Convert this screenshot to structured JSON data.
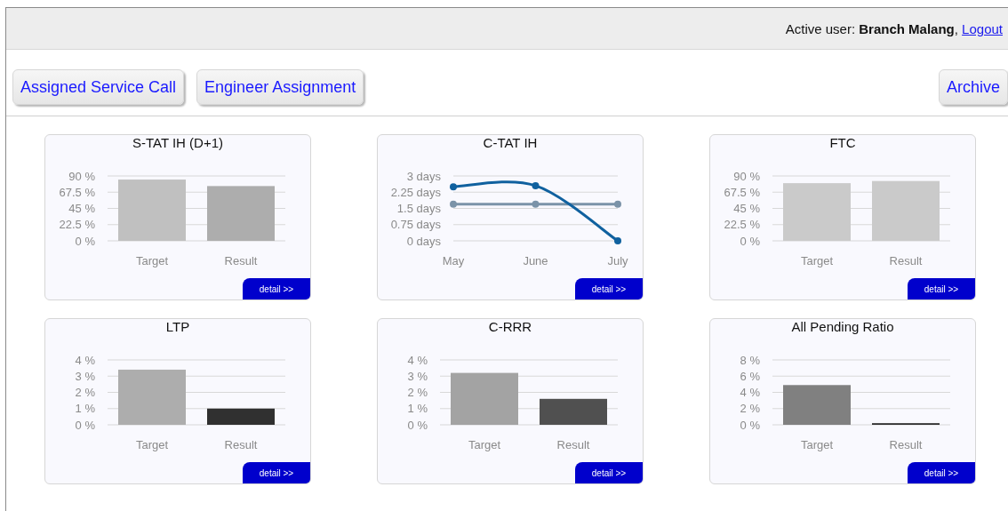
{
  "header": {
    "user_text": "Active user: **Branch Malang**,",
    "logout": "Logout"
  },
  "nav": {
    "left": [
      {
        "label": "Assigned Service Call"
      },
      {
        "label": "Engineer Assignment"
      }
    ],
    "right": [
      {
        "label": "Archive"
      }
    ]
  },
  "cards": [
    {
      "title": "S-TAT IH (D+1)",
      "detail": "detail >>",
      "chart_data": {
        "type": "bar",
        "grid": true,
        "categories": [
          "Target",
          "Result"
        ],
        "series": [
          {
            "color": "#c0c0c0",
            "values": [
              85,
              null
            ]
          },
          {
            "color": "#adadad",
            "values": [
              null,
              76
            ]
          }
        ],
        "ylim": [
          0,
          90
        ],
        "yticks": [
          {
            "value": 0,
            "label": "0 %"
          },
          {
            "value": 22.5,
            "label": "22.5 %"
          },
          {
            "value": 45,
            "label": "45 %"
          },
          {
            "value": 67.5,
            "label": "67.5 %"
          },
          {
            "value": 90,
            "label": "90 %"
          }
        ]
      }
    },
    {
      "title": "C-TAT IH",
      "detail": "detail >>",
      "chart_data": {
        "type": "line",
        "grid": true,
        "categories": [
          "May",
          "June",
          "July"
        ],
        "series": [
          {
            "color": "#7b93a8",
            "marker": true,
            "values": [
              1.7,
              1.7,
              1.7
            ]
          },
          {
            "color": "#10619f",
            "marker": true,
            "values": [
              2.5,
              2.55,
              0
            ]
          }
        ],
        "ylim": [
          0,
          3
        ],
        "yticks": [
          {
            "value": 0,
            "label": "0 days"
          },
          {
            "value": 0.75,
            "label": "0.75 days"
          },
          {
            "value": 1.5,
            "label": "1.5 days"
          },
          {
            "value": 2.25,
            "label": "2.25 days"
          },
          {
            "value": 3,
            "label": "3 days"
          }
        ]
      }
    },
    {
      "title": "FTC",
      "detail": "detail >>",
      "chart_data": {
        "type": "bar",
        "grid": true,
        "categories": [
          "Target",
          "Result"
        ],
        "series": [
          {
            "color": "#cacaca",
            "values": [
              80,
              null
            ]
          },
          {
            "color": "#cacaca",
            "values": [
              null,
              83
            ]
          }
        ],
        "ylim": [
          0,
          90
        ],
        "yticks": [
          {
            "value": 0,
            "label": "0 %"
          },
          {
            "value": 22.5,
            "label": "22.5 %"
          },
          {
            "value": 45,
            "label": "45 %"
          },
          {
            "value": 67.5,
            "label": "67.5 %"
          },
          {
            "value": 90,
            "label": "90 %"
          }
        ]
      }
    },
    {
      "title": "LTP",
      "detail": "detail >>",
      "chart_data": {
        "type": "bar",
        "grid": true,
        "categories": [
          "Target",
          "Result"
        ],
        "series": [
          {
            "color": "#adadad",
            "values": [
              3.4,
              null
            ]
          },
          {
            "color": "#303030",
            "values": [
              null,
              1
            ]
          }
        ],
        "ylim": [
          0,
          4
        ],
        "yticks": [
          {
            "value": 0,
            "label": "0 %"
          },
          {
            "value": 1,
            "label": "1 %"
          },
          {
            "value": 2,
            "label": "2 %"
          },
          {
            "value": 3,
            "label": "3 %"
          },
          {
            "value": 4,
            "label": "4 %"
          }
        ]
      }
    },
    {
      "title": "C-RRR",
      "detail": "detail >>",
      "chart_data": {
        "type": "bar",
        "grid": true,
        "categories": [
          "Target",
          "Result"
        ],
        "series": [
          {
            "color": "#a3a3a3",
            "values": [
              3.2,
              null
            ]
          },
          {
            "color": "#505050",
            "values": [
              null,
              1.6
            ]
          }
        ],
        "ylim": [
          0,
          4
        ],
        "yticks": [
          {
            "value": 0,
            "label": "0 %"
          },
          {
            "value": 1,
            "label": "1 %"
          },
          {
            "value": 2,
            "label": "2 %"
          },
          {
            "value": 3,
            "label": "3 %"
          },
          {
            "value": 4,
            "label": "4 %"
          }
        ]
      }
    },
    {
      "title": "All Pending Ratio",
      "detail": "detail >>",
      "chart_data": {
        "type": "bar",
        "grid": true,
        "categories": [
          "Target",
          "Result"
        ],
        "series": [
          {
            "color": "#808080",
            "values": [
              4.9,
              null
            ]
          },
          {
            "color": "#303030",
            "values": [
              null,
              0.2
            ]
          }
        ],
        "ylim": [
          0,
          8
        ],
        "yticks": [
          {
            "value": 0,
            "label": "0 %"
          },
          {
            "value": 2,
            "label": "2 %"
          },
          {
            "value": 4,
            "label": "4 %"
          },
          {
            "value": 6,
            "label": "6 %"
          },
          {
            "value": 8,
            "label": "8 %"
          }
        ]
      }
    }
  ]
}
